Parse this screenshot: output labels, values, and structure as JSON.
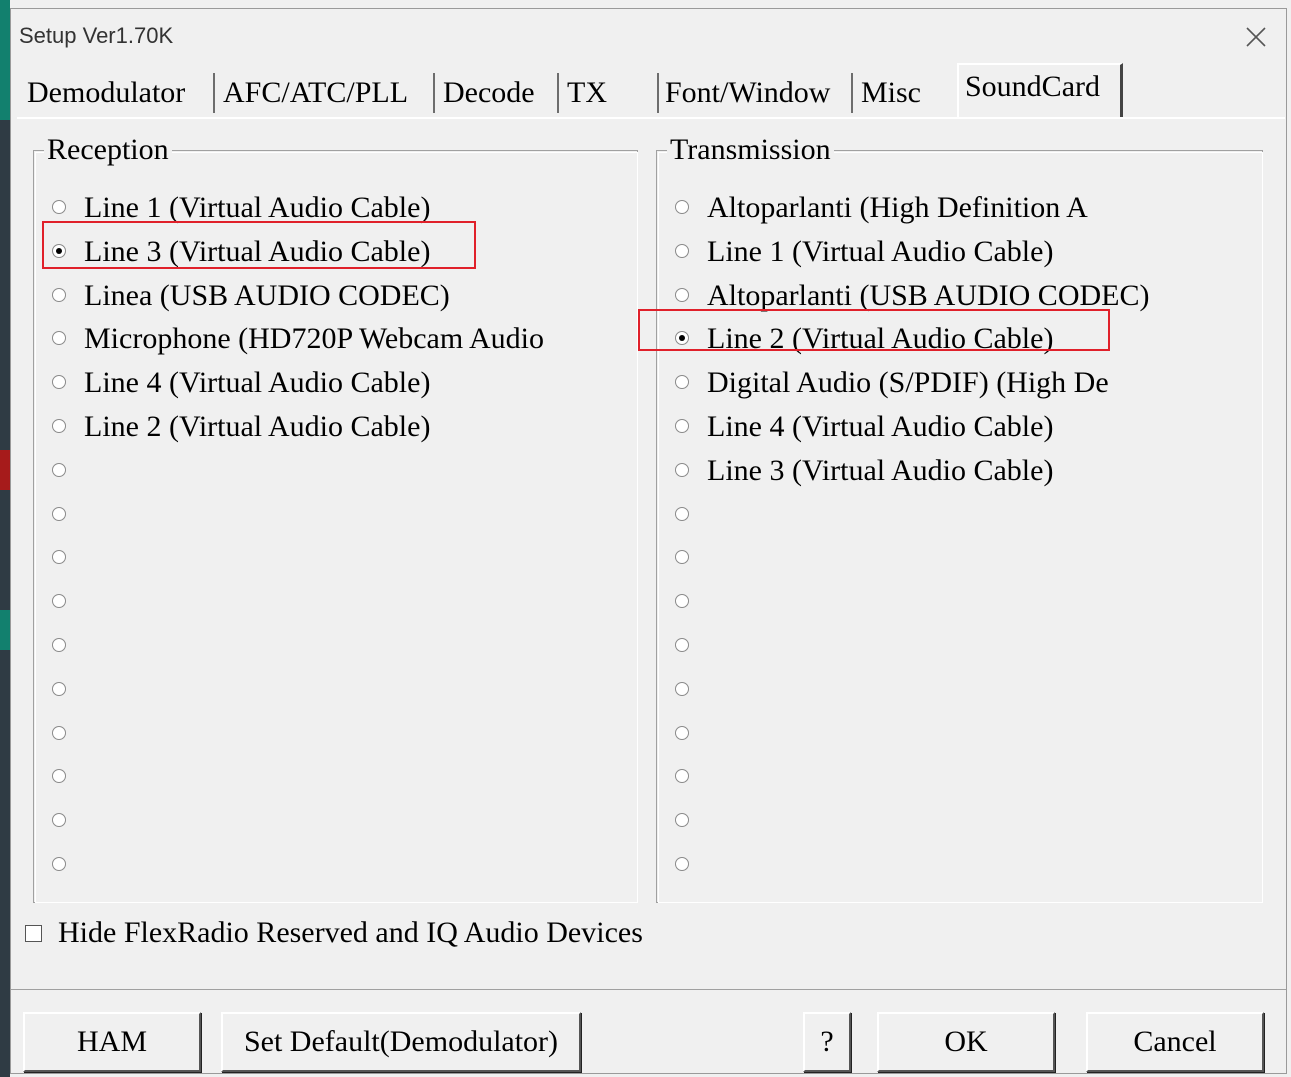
{
  "window": {
    "title": "Setup Ver1.70K"
  },
  "tabs": [
    {
      "label": "Demodulator"
    },
    {
      "label": "AFC/ATC/PLL"
    },
    {
      "label": "Decode"
    },
    {
      "label": "TX"
    },
    {
      "label": "Font/Window"
    },
    {
      "label": "Misc"
    },
    {
      "label": "SoundCard",
      "active": true
    }
  ],
  "reception": {
    "legend": "Reception",
    "options": [
      {
        "label": "Line 1 (Virtual Audio Cable)",
        "checked": false
      },
      {
        "label": "Line 3 (Virtual Audio Cable)",
        "checked": true
      },
      {
        "label": "Linea (USB AUDIO  CODEC)",
        "checked": false
      },
      {
        "label": "Microphone (HD720P Webcam Audio",
        "checked": false
      },
      {
        "label": "Line 4 (Virtual Audio Cable)",
        "checked": false
      },
      {
        "label": "Line 2 (Virtual Audio Cable)",
        "checked": false
      },
      {
        "label": "",
        "checked": false
      },
      {
        "label": "",
        "checked": false
      },
      {
        "label": "",
        "checked": false
      },
      {
        "label": "",
        "checked": false
      },
      {
        "label": "",
        "checked": false
      },
      {
        "label": "",
        "checked": false
      },
      {
        "label": "",
        "checked": false
      },
      {
        "label": "",
        "checked": false
      },
      {
        "label": "",
        "checked": false
      },
      {
        "label": "",
        "checked": false
      }
    ]
  },
  "transmission": {
    "legend": "Transmission",
    "options": [
      {
        "label": "Altoparlanti (High Definition A",
        "checked": false
      },
      {
        "label": "Line 1 (Virtual Audio Cable)",
        "checked": false
      },
      {
        "label": "Altoparlanti (USB AUDIO  CODEC)",
        "checked": false
      },
      {
        "label": "Line 2 (Virtual Audio Cable)",
        "checked": true
      },
      {
        "label": "Digital Audio (S/PDIF) (High De",
        "checked": false
      },
      {
        "label": "Line 4 (Virtual Audio Cable)",
        "checked": false
      },
      {
        "label": "Line 3 (Virtual Audio Cable)",
        "checked": false
      },
      {
        "label": "",
        "checked": false
      },
      {
        "label": "",
        "checked": false
      },
      {
        "label": "",
        "checked": false
      },
      {
        "label": "",
        "checked": false
      },
      {
        "label": "",
        "checked": false
      },
      {
        "label": "",
        "checked": false
      },
      {
        "label": "",
        "checked": false
      },
      {
        "label": "",
        "checked": false
      },
      {
        "label": "",
        "checked": false
      }
    ]
  },
  "hide_flex": {
    "label": "Hide FlexRadio Reserved and IQ Audio Devices",
    "checked": false
  },
  "buttons": {
    "ham": "HAM",
    "set_default": "Set Default(Demodulator)",
    "help": "?",
    "ok": "OK",
    "cancel": "Cancel"
  },
  "colors": {
    "highlight": "#e0202a",
    "window_bg": "#f0f0f0"
  }
}
